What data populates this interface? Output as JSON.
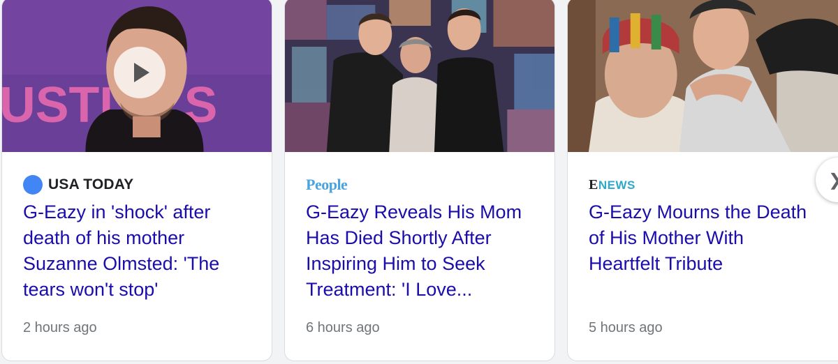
{
  "cards": [
    {
      "source": "USA TODAY",
      "headline": "G-Eazy in 'shock' after death of his mother Suzanne Olmsted: 'The tears won't stop'",
      "time": "2 hours ago",
      "has_video": true
    },
    {
      "source": "People",
      "headline": "G-Eazy Reveals His Mom Has Died Shortly After Inspiring Him to Seek Treatment: 'I Love...",
      "time": "6 hours ago",
      "has_video": false
    },
    {
      "source_prefix": "E",
      "source": "NEWS",
      "headline": "G-Eazy Mourns the Death of His Mother With Heartfelt Tribute",
      "time": "5 hours ago",
      "has_video": false
    }
  ],
  "thumb_text": "USTL",
  "next_icon": "chevron-right-icon",
  "colors": {
    "headline": "#1a0dab",
    "time": "#70757a",
    "usa_today_dot": "#4285f4",
    "people": "#4aa3df",
    "enews": "#2fa8c9"
  }
}
